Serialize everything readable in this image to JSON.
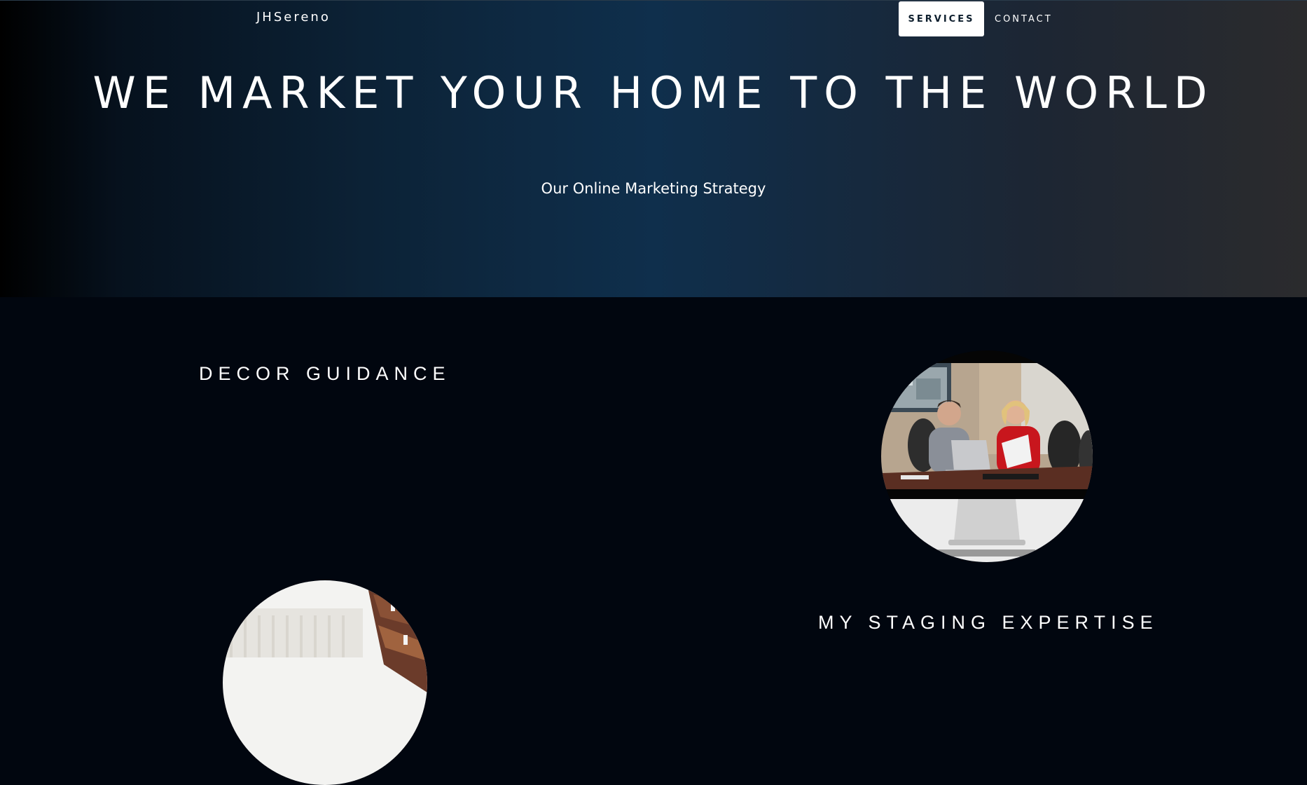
{
  "header": {
    "brand": "JHSereno",
    "nav": [
      {
        "label": "SERVICES",
        "active": true
      },
      {
        "label": "CONTACT",
        "active": false
      }
    ]
  },
  "hero": {
    "title": "WE MARKET YOUR HOME TO THE WORLD",
    "subtitle": "Our Online Marketing Strategy"
  },
  "sections": {
    "decor_title": "DECOR GUIDANCE",
    "staging_title": "MY STAGING EXPERTISE"
  },
  "images": {
    "meeting_photo": "video-call-meeting-photo",
    "interior_photo": "interior-room-photo"
  },
  "colors": {
    "page_background": "#01060f",
    "hero_center": "#0f2f4c",
    "active_nav_bg": "#ffffff"
  }
}
